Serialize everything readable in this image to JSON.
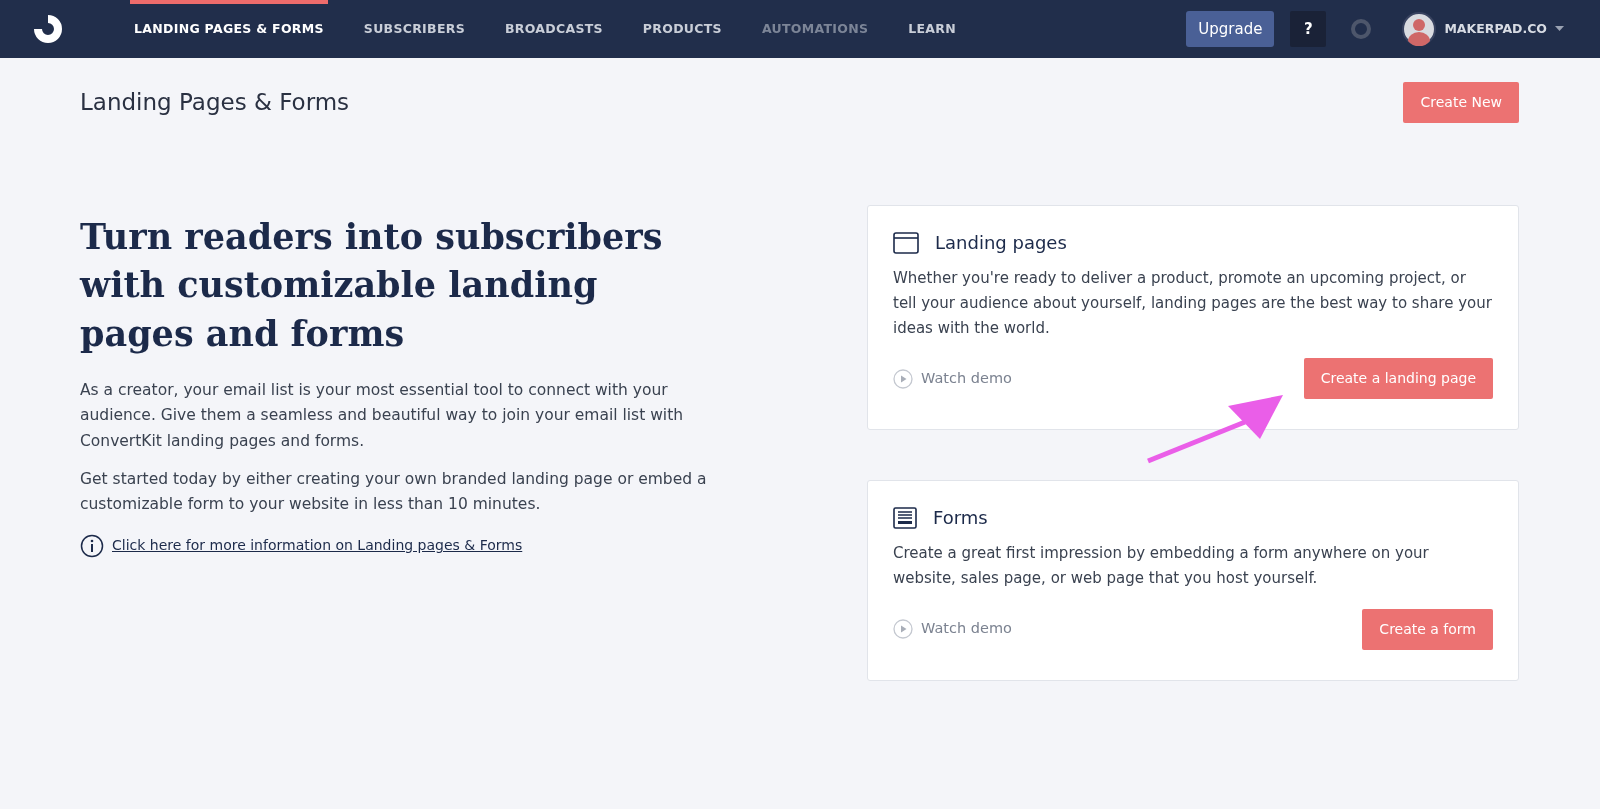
{
  "nav": {
    "items": [
      {
        "label": "LANDING PAGES & FORMS",
        "selected": true,
        "disabled": false
      },
      {
        "label": "SUBSCRIBERS",
        "selected": false,
        "disabled": false
      },
      {
        "label": "BROADCASTS",
        "selected": false,
        "disabled": false
      },
      {
        "label": "PRODUCTS",
        "selected": false,
        "disabled": false
      },
      {
        "label": "AUTOMATIONS",
        "selected": false,
        "disabled": true
      },
      {
        "label": "LEARN",
        "selected": false,
        "disabled": false
      }
    ],
    "upgrade_button": "Upgrade",
    "help_button": "?",
    "account": "MAKERPAD.CO"
  },
  "page_title": "Landing Pages & Forms",
  "create_new_button": "Create New",
  "intro": {
    "headline": "Turn readers into subscribers with customizable landing pages and forms",
    "paragraphs": [
      "As a creator, your email list is your most essential tool to connect with your audience. Give them a seamless and beautiful way to join your email list with ConvertKit landing pages and forms.",
      "Get started today by either creating your own branded landing page or embed a customizable form to your website in less than 10 minutes."
    ],
    "info_link": "Click here for more information on Landing pages & Forms"
  },
  "cards": [
    {
      "kind": "landing",
      "title": "Landing pages",
      "description": "Whether you're ready to deliver a product, promote an upcoming project, or tell your audience about yourself, landing pages are the best way to share your ideas with the world.",
      "demo_link": "Watch demo",
      "button": "Create a landing page"
    },
    {
      "kind": "form",
      "title": "Forms",
      "description": "Create a great first impression by embedding a form anywhere on your website, sales page, or web page that you host yourself.",
      "demo_link": "Watch demo",
      "button": "Create a form"
    }
  ]
}
